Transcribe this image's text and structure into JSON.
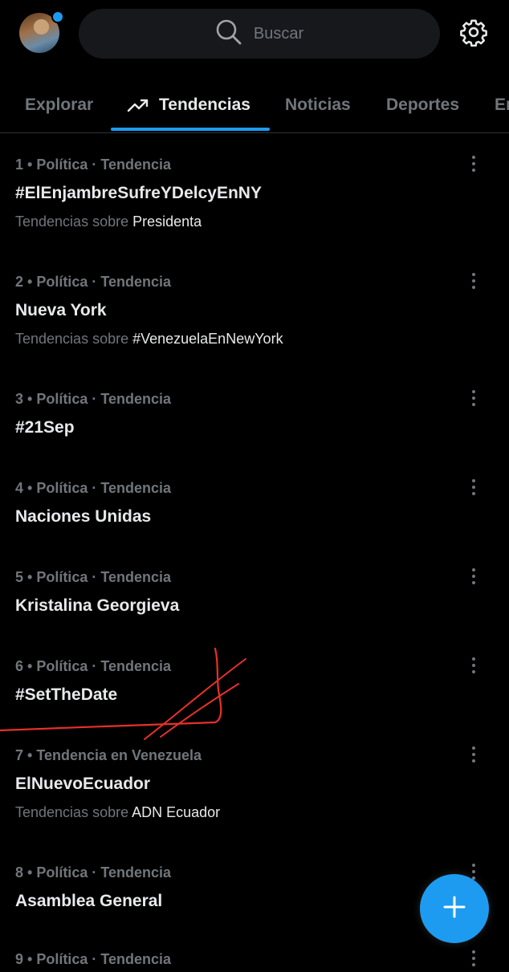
{
  "search": {
    "placeholder": "Buscar"
  },
  "tabs": [
    {
      "label": "Explorar"
    },
    {
      "label": "Tendencias"
    },
    {
      "label": "Noticias"
    },
    {
      "label": "Deportes"
    },
    {
      "label": "En"
    }
  ],
  "trends": [
    {
      "meta": "1 • Política · Tendencia",
      "title": "#ElEnjambreSufreYDelcyEnNY",
      "sub_prefix": "Tendencias sobre ",
      "sub_topic": "Presidenta"
    },
    {
      "meta": "2 • Política · Tendencia",
      "title": "Nueva York",
      "sub_prefix": "Tendencias sobre ",
      "sub_topic": "#VenezuelaEnNewYork"
    },
    {
      "meta": "3 • Política · Tendencia",
      "title": "#21Sep"
    },
    {
      "meta": "4 • Política · Tendencia",
      "title": "Naciones Unidas"
    },
    {
      "meta": "5 • Política · Tendencia",
      "title": "Kristalina Georgieva"
    },
    {
      "meta": "6 • Política · Tendencia",
      "title": "#SetTheDate"
    },
    {
      "meta": "7 • Tendencia en Venezuela",
      "title": "ElNuevoEcuador",
      "sub_prefix": "Tendencias sobre ",
      "sub_topic": "ADN Ecuador"
    },
    {
      "meta": "8 • Política · Tendencia",
      "title": "Asamblea General"
    },
    {
      "meta": "9 • Política · Tendencia"
    }
  ],
  "colors": {
    "accent": "#1d9bf0",
    "annotation": "#e8302a"
  },
  "icons": {
    "search": "search-icon",
    "settings": "gear-icon",
    "trending": "trending-up-icon",
    "more": "more-vertical-icon",
    "compose": "plus-icon"
  }
}
